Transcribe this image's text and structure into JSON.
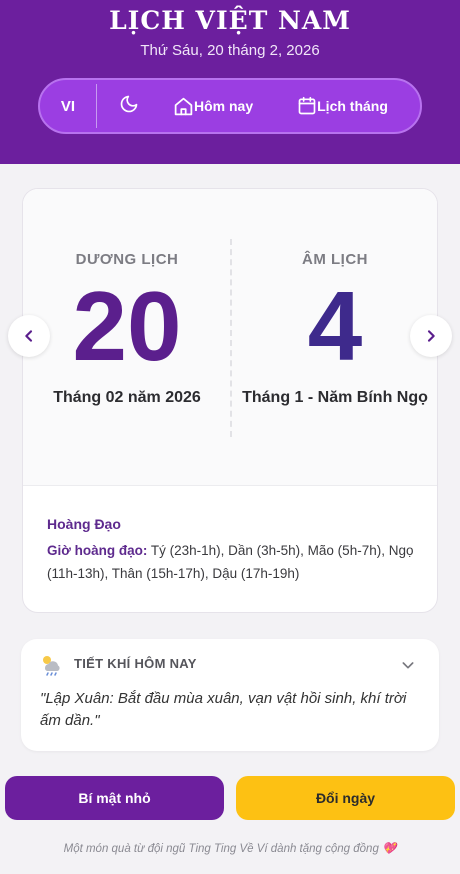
{
  "header": {
    "title": "LỊCH VIỆT NAM",
    "date": "Thứ Sáu, 20 tháng 2, 2026"
  },
  "nav": {
    "lang": "VI",
    "today": "Hôm nay",
    "month_calendar": "Lịch tháng"
  },
  "solar": {
    "label": "DƯƠNG LỊCH",
    "day": "20",
    "sub": "Tháng 02 năm 2026"
  },
  "lunar": {
    "label": "ÂM LỊCH",
    "day": "4",
    "sub": "Tháng 1 - Năm Bính Ngọ"
  },
  "hoang_dao": {
    "title": "Hoàng Đạo",
    "hours_label": "Giờ hoàng đạo:",
    "hours": "Tý (23h-1h), Dần (3h-5h), Mão (5h-7h), Ngọ (11h-13h), Thân (15h-17h), Dậu (17h-19h)"
  },
  "tiet_khi": {
    "title": "TIẾT KHÍ HÔM NAY",
    "quote": "\"Lập Xuân: Bắt đầu mùa xuân, vạn vật hồi sinh, khí trời ấm dần.\""
  },
  "buttons": {
    "secret": "Bí mật nhỏ",
    "convert": "Đổi ngày"
  },
  "footer": "Một món quà từ đội ngũ Ting Ting Về Ví dành tặng cộng đồng 💖",
  "colors": {
    "primary": "#6c1f9e",
    "accent": "#fdc113"
  }
}
